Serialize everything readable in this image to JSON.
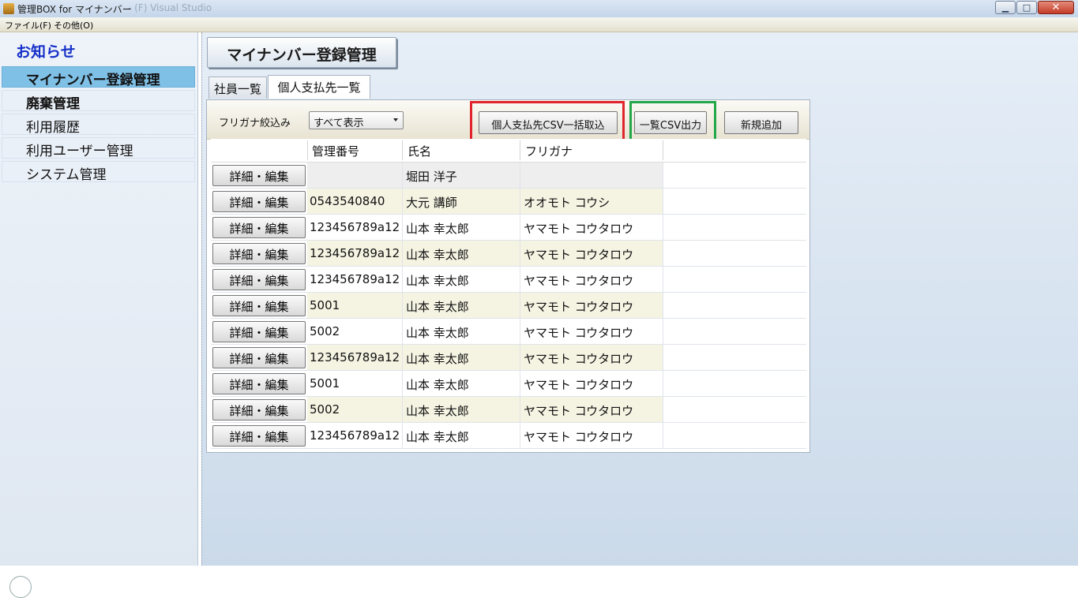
{
  "window": {
    "title": "管理BOX for マイナンバー",
    "title_faded": "- (F) Visual Studio",
    "buttons": {
      "minimize": "▁",
      "maximize": "□",
      "close": "✕"
    }
  },
  "menu": {
    "file": "ファイル(F)",
    "other": "その他(O)"
  },
  "sidebar": {
    "header": "お知らせ",
    "items": [
      {
        "label": "マイナンバー登録管理"
      },
      {
        "label": "廃棄管理"
      },
      {
        "label": "利用履歴"
      },
      {
        "label": "利用ユーザー管理"
      },
      {
        "label": "システム管理"
      }
    ]
  },
  "main": {
    "page_title": "マイナンバー登録管理",
    "tabs": [
      {
        "label": "社員一覧"
      },
      {
        "label": "個人支払先一覧"
      }
    ],
    "toolbar": {
      "filter_label": "フリガナ絞込み",
      "filter_value": "すべて表示",
      "import_button": "個人支払先CSV一括取込",
      "export_button": "一覧CSV出力",
      "add_button": "新規追加"
    },
    "grid": {
      "columns": [
        "管理番号",
        "氏名",
        "フリガナ"
      ],
      "edit_label": "詳細・編集",
      "rows": [
        {
          "id": "",
          "name": "堀田 洋子",
          "kana": ""
        },
        {
          "id": "0543540840",
          "name": "大元 講師",
          "kana": "オオモト コウシ"
        },
        {
          "id": "123456789a12",
          "name": "山本 幸太郎",
          "kana": "ヤマモト コウタロウ"
        },
        {
          "id": "123456789a12",
          "name": "山本 幸太郎",
          "kana": "ヤマモト コウタロウ"
        },
        {
          "id": "123456789a12",
          "name": "山本 幸太郎",
          "kana": "ヤマモト コウタロウ"
        },
        {
          "id": "5001",
          "name": "山本 幸太郎",
          "kana": "ヤマモト コウタロウ"
        },
        {
          "id": "5002",
          "name": "山本 幸太郎",
          "kana": "ヤマモト コウタロウ"
        },
        {
          "id": "123456789a12",
          "name": "山本 幸太郎",
          "kana": "ヤマモト コウタロウ"
        },
        {
          "id": "5001",
          "name": "山本 幸太郎",
          "kana": "ヤマモト コウタロウ"
        },
        {
          "id": "5002",
          "name": "山本 幸太郎",
          "kana": "ヤマモト コウタロウ"
        },
        {
          "id": "123456789a12",
          "name": "山本 幸太郎",
          "kana": "ヤマモト コウタロウ"
        }
      ]
    }
  },
  "colors": {
    "highlight_import": "#e1232b",
    "highlight_export": "#22a84a",
    "active_sidebar": "#7fc0e6"
  }
}
